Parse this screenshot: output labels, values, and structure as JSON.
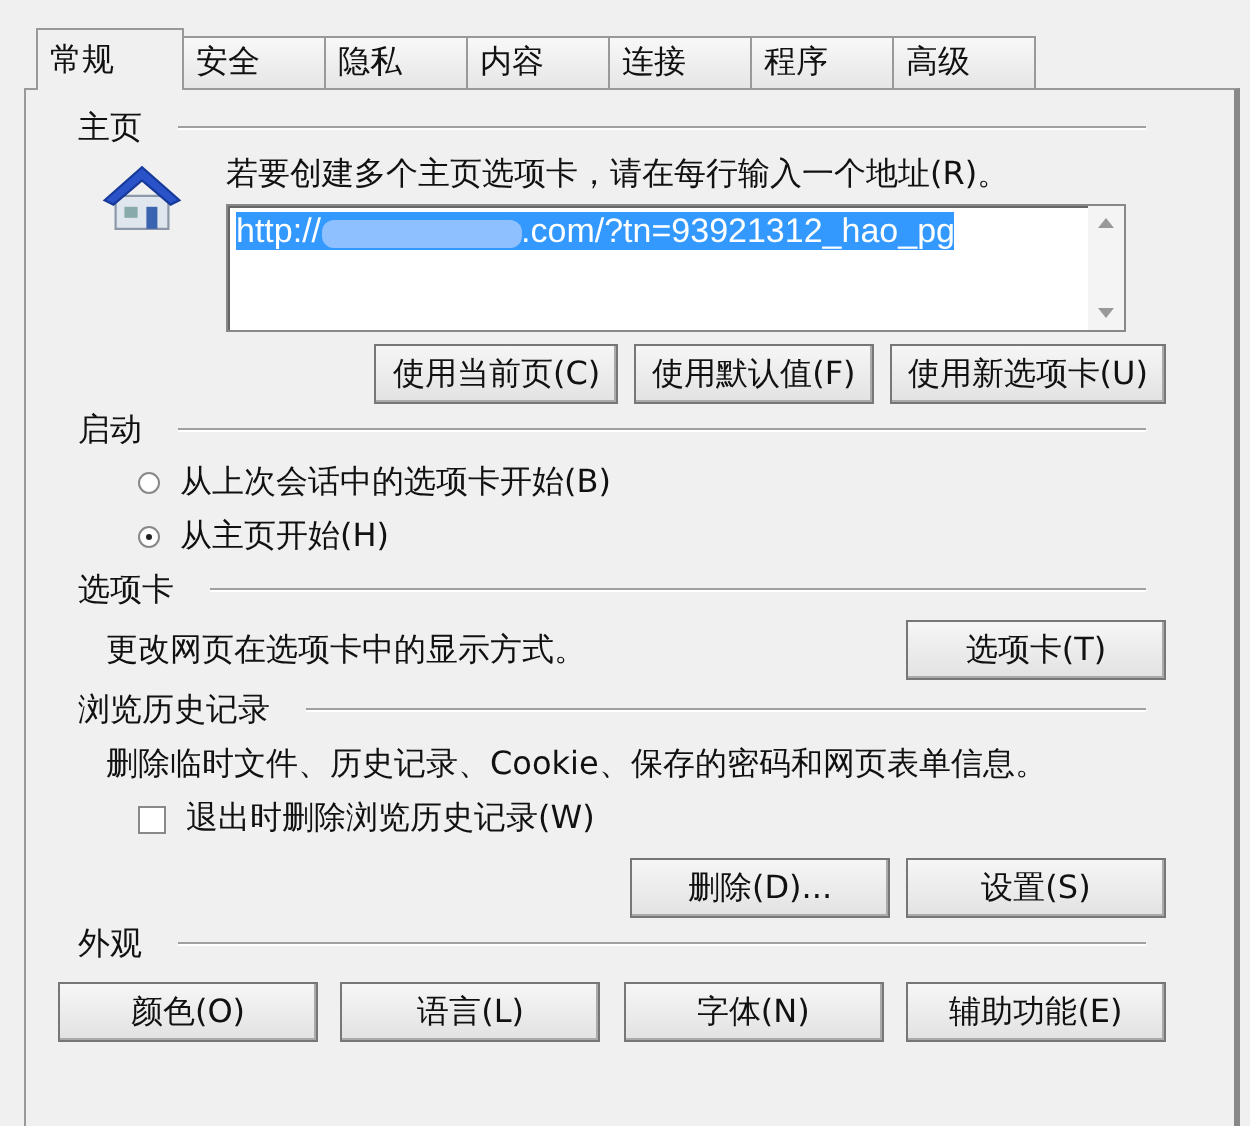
{
  "tabs": [
    {
      "label": "常规",
      "selected": true
    },
    {
      "label": "安全",
      "selected": false
    },
    {
      "label": "隐私",
      "selected": false
    },
    {
      "label": "内容",
      "selected": false
    },
    {
      "label": "连接",
      "selected": false
    },
    {
      "label": "程序",
      "selected": false
    },
    {
      "label": "高级",
      "selected": false
    }
  ],
  "home": {
    "title": "主页",
    "prompt": "若要创建多个主页选项卡，请在每行输入一个地址(R)。",
    "url_start": "http://",
    "url_end": ".com/?tn=93921312_hao_pg",
    "url_selected": true,
    "buttons": [
      "使用当前页(C)",
      "使用默认值(F)",
      "使用新选项卡(U)"
    ]
  },
  "startup": {
    "title": "启动",
    "options": [
      {
        "label": "从上次会话中的选项卡开始(B)",
        "selected": false
      },
      {
        "label": "从主页开始(H)",
        "selected": true
      }
    ]
  },
  "tabs_section": {
    "title": "选项卡",
    "text": "更改网页在选项卡中的显示方式。",
    "button": "选项卡(T)"
  },
  "history": {
    "title": "浏览历史记录",
    "text": "删除临时文件、历史记录、Cookie、保存的密码和网页表单信息。",
    "checkbox": {
      "label": "退出时删除浏览历史记录(W)",
      "checked": false
    },
    "buttons": [
      "删除(D)...",
      "设置(S)"
    ]
  },
  "appearance": {
    "title": "外观",
    "buttons": [
      "颜色(O)",
      "语言(L)",
      "字体(N)",
      "辅助功能(E)"
    ]
  }
}
